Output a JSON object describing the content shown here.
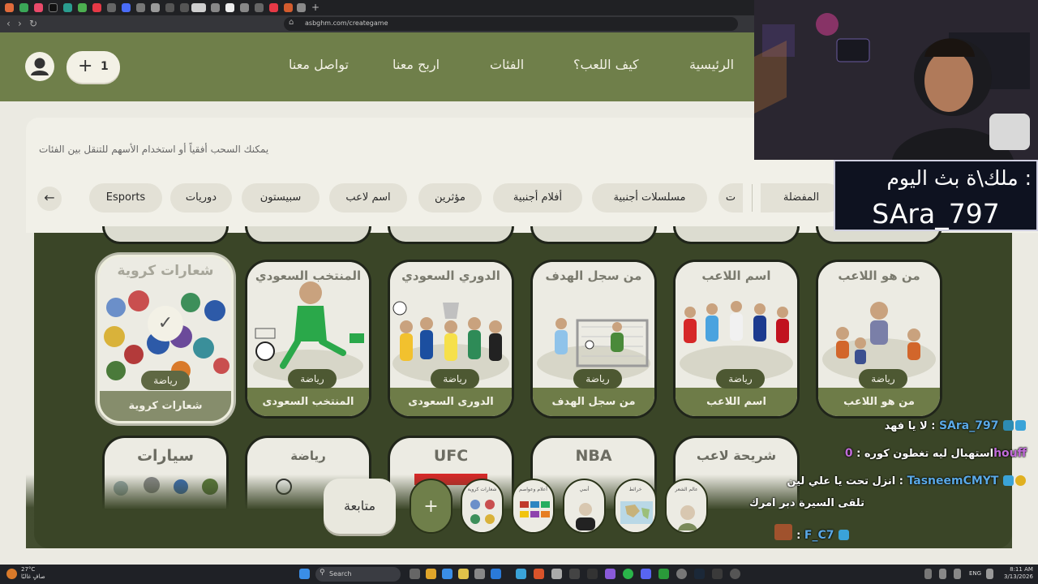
{
  "browser": {
    "url": "asbghm.com/creategame"
  },
  "nav": {
    "links": [
      "الرئيسية",
      "كيف اللعب؟",
      "الفئات",
      "اربح معنا",
      "تواصل معنا"
    ],
    "count": "1",
    "count_plus": "+"
  },
  "filter": {
    "hint": "يمكنك السحب أفقياً أو استخدام الأسهم للتنقل بين الفئات",
    "chips": [
      "المفضلة",
      "ت",
      "مسلسلات أجنبية",
      "أفلام أجنبية",
      "مؤثرين",
      "اسم لاعب",
      "سبيستون",
      "دوريات",
      "Esports"
    ],
    "back_glyph": "←"
  },
  "cards": [
    {
      "art_title": "من هو اللاعب",
      "name": "من هو اللاعب",
      "tag": "رياضة"
    },
    {
      "art_title": "اسم اللاعب",
      "name": "اسم اللاعب",
      "tag": "رياضة"
    },
    {
      "art_title": "من سجل الهدف",
      "name": "من سجل الهدف",
      "tag": "رياضة"
    },
    {
      "art_title": "الدوري السعودي",
      "name": "الدورى السعودى",
      "tag": "رياضة"
    },
    {
      "art_title": "المنتخب السعودي",
      "name": "المنتخب السعودى",
      "tag": "رياضة"
    },
    {
      "art_title": "شعارات كروية",
      "name": "شعارات كروية",
      "tag": "رياضة",
      "selected": true
    }
  ],
  "next_row": [
    "سيارات",
    "رياضة",
    "UFC",
    "NBA",
    "شريحة لاعب"
  ],
  "tray": {
    "continue": "متابعة",
    "add": "+",
    "thumbs": [
      "عالم الشعر",
      "خرائط",
      "أنمي",
      "أعلام وعواصم",
      "شعارات كروية"
    ]
  },
  "stream": {
    "banner_label": "ملك\\ة بث اليوم :",
    "banner_name": "SAra_797"
  },
  "chat": [
    {
      "user": "SAra_797",
      "message": "لا يا فهد",
      "color": "#5aa9e6"
    },
    {
      "user": "0houff",
      "message": "استهبال ليه تغطون كوره",
      "color": "#c06bd8"
    },
    {
      "user": "TasneemCMYT",
      "message": "انزل تحت يا علي لين",
      "color": "#5aa9e6"
    },
    {
      "user": "",
      "message": "تلقى السيرة دبر امرك",
      "color": "#ffffff"
    },
    {
      "user": "F_C7",
      "message": "",
      "color": "#5aa9e6"
    }
  ],
  "taskbar": {
    "search": "Search",
    "weather_temp": "27°C",
    "weather_desc": "صافٍ غالبًا",
    "lang": "ENG",
    "time": "8:11 AM",
    "date": "3/13/2026"
  },
  "colors": {
    "nav_green": "#6f7f4a",
    "board_green": "#3a4527",
    "cream": "#ebeae2"
  }
}
